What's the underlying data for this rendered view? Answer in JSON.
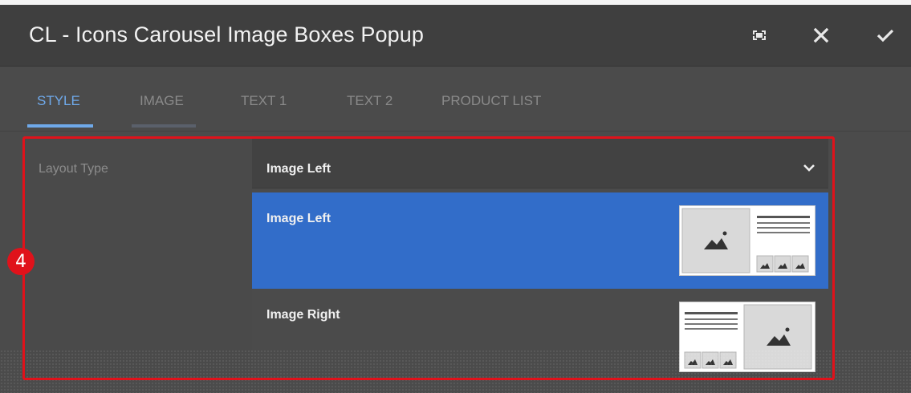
{
  "dialog": {
    "title": "CL - Icons Carousel Image Boxes Popup",
    "icons": [
      "fullscreen-icon",
      "close-icon",
      "checkmark-icon"
    ]
  },
  "tabs": [
    {
      "label": "STYLE",
      "active": true
    },
    {
      "label": "IMAGE",
      "active": false
    },
    {
      "label": "TEXT 1",
      "active": false
    },
    {
      "label": "TEXT 2",
      "active": false
    },
    {
      "label": "PRODUCT LIST",
      "active": false
    }
  ],
  "field": {
    "label": "Layout Type",
    "selected_value": "Image Left",
    "options": [
      {
        "label": "Image Left",
        "selected": true
      },
      {
        "label": "Image Right",
        "selected": false
      }
    ]
  },
  "annotation": {
    "badge_number": "4",
    "color": "#e0121b"
  },
  "colors": {
    "accent_blue": "#326dc9",
    "tab_active": "#6fa9ea",
    "background": "#4b4b4b"
  }
}
